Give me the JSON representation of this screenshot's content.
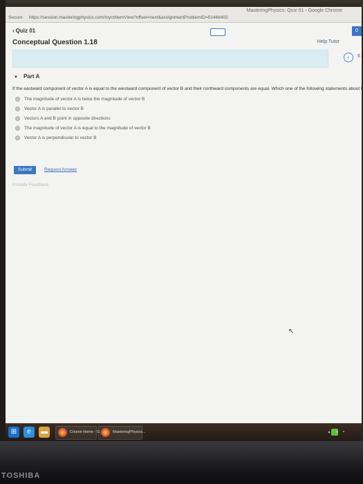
{
  "browser": {
    "window_title": "MasteringPhysics: Quiz 01 - Google Chrome",
    "secure_label": "Secure",
    "url": "https://session.masteringphysics.com/myct/itemView?offset=next&assignmentProblemID=91466402"
  },
  "header": {
    "back_label": "Quiz 01",
    "question_title": "Conceptual Question 1.18",
    "help_label": "Help   Tutor",
    "accent_tab": "0",
    "page_num": "6"
  },
  "part": {
    "label": "Part A",
    "prompt": "If the eastward component of vector A is equal to the westward component of vector B and their northward components are equal. Which one of the following statements about these two vectors is correct?",
    "options": [
      "The magnitude of vector A is twice the magnitude of vector B",
      "Vector A is parallel to vector B",
      "Vectors A and B point in opposite directions",
      "The magnitude of vector A is equal to the magnitude of vector B",
      "Vector A is perpendicular to vector B"
    ],
    "submit_label": "Submit",
    "request_label": "Request Answer",
    "feedback_label": "Provide Feedback"
  },
  "taskbar": {
    "items": [
      {
        "label": "Course Home - G..."
      },
      {
        "label": "MasteringPhysics..."
      }
    ]
  },
  "brand": "TOSHIBA",
  "colors": {
    "accent": "#3b77c3",
    "banner": "#d9ecf1"
  }
}
